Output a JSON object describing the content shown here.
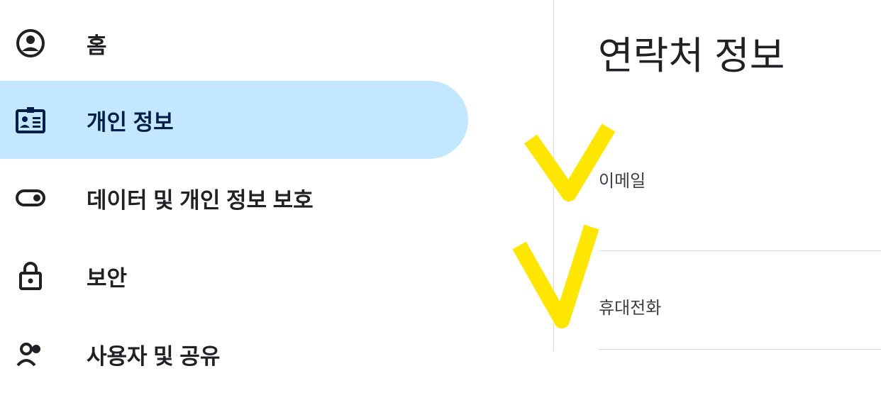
{
  "sidebar": {
    "items": [
      {
        "label": "홈",
        "icon": "account-circle-icon",
        "active": false
      },
      {
        "label": "개인 정보",
        "icon": "badge-icon",
        "active": true
      },
      {
        "label": "데이터 및 개인 정보 보호",
        "icon": "toggle-icon",
        "active": false
      },
      {
        "label": "보안",
        "icon": "lock-icon",
        "active": false
      },
      {
        "label": "사용자 및 공유",
        "icon": "people-icon",
        "active": false
      }
    ]
  },
  "main": {
    "title": "연락처 정보",
    "rows": [
      {
        "label": "이메일"
      },
      {
        "label": "휴대전화"
      }
    ]
  },
  "colors": {
    "active_bg": "#c2e7ff",
    "annotation": "#ffe600"
  }
}
